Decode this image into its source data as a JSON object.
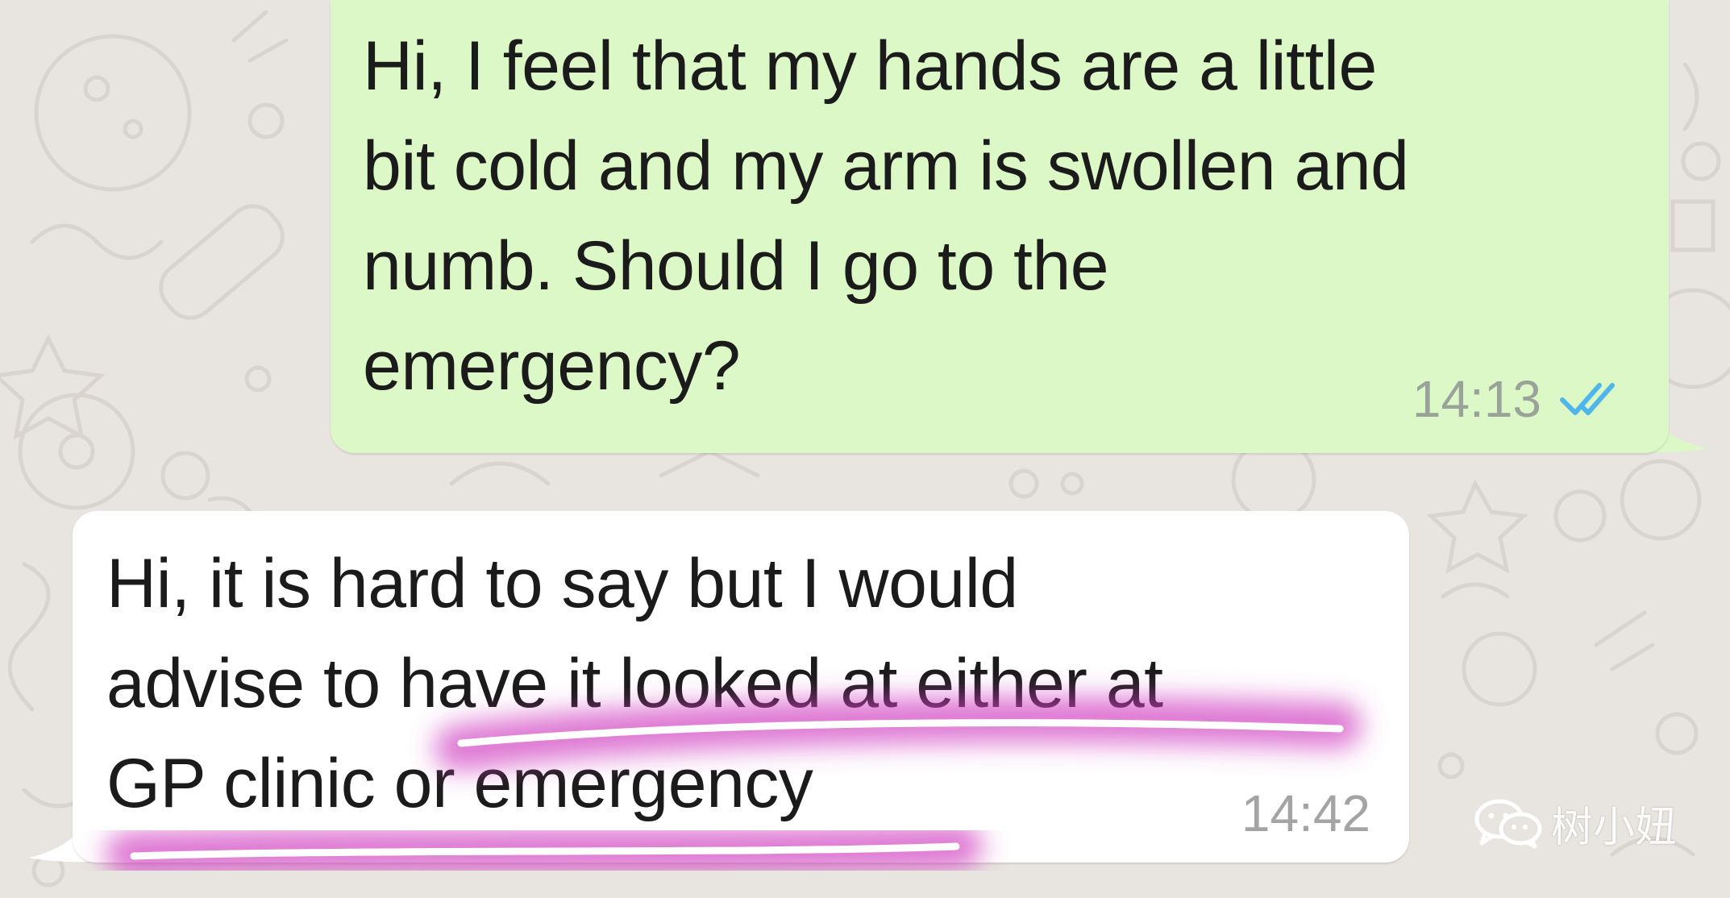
{
  "chat": {
    "messages": [
      {
        "direction": "outgoing",
        "lines": [
          "Hi, I feel that my hands are a little",
          "bit cold and my arm is swollen and",
          "numb. Should I go to the",
          "emergency?"
        ],
        "time": "14:13",
        "status_icon": "double-check-read-icon",
        "bubble_color": "#dcf8c6"
      },
      {
        "direction": "incoming",
        "lines": [
          "Hi, it is hard to say but I would",
          "advise to have it looked at either at",
          "GP clinic or emergency"
        ],
        "time": "14:42",
        "bubble_color": "#ffffff",
        "highlighted_text": "have it looked at either at GP clinic or emergency"
      }
    ]
  },
  "colors": {
    "wallpaper": "#e8e4df",
    "read_ticks": "#4fb6ec",
    "highlight_marker": "#d03fc0"
  },
  "watermark": {
    "label": "树小妞",
    "icon": "wechat-icon"
  }
}
